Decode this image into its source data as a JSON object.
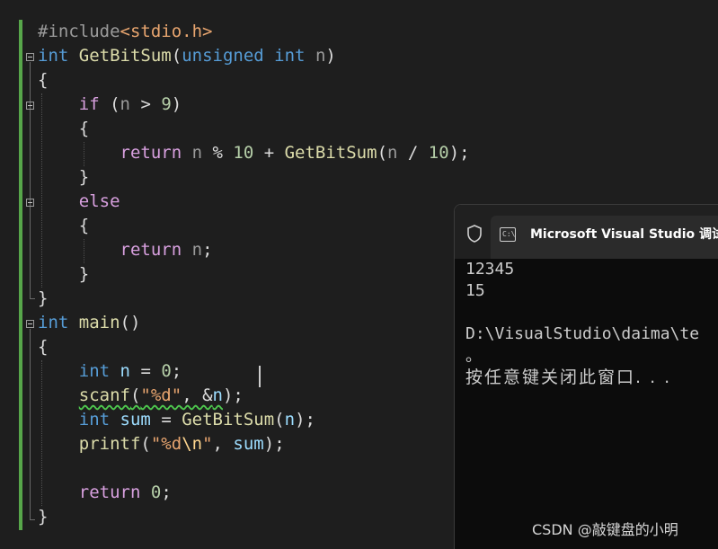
{
  "editor": {
    "lines": [
      {
        "tokens": [
          {
            "t": "#include",
            "c": "pp"
          },
          {
            "t": "<stdio.h>",
            "c": "inc"
          }
        ]
      },
      {
        "tokens": [
          {
            "t": "int",
            "c": "kw"
          },
          {
            "t": " ",
            "c": ""
          },
          {
            "t": "GetBitSum",
            "c": "fn"
          },
          {
            "t": "(",
            "c": ""
          },
          {
            "t": "unsigned",
            "c": "kw"
          },
          {
            "t": " ",
            "c": ""
          },
          {
            "t": "int",
            "c": "kw"
          },
          {
            "t": " ",
            "c": ""
          },
          {
            "t": "n",
            "c": "param"
          },
          {
            "t": ")",
            "c": ""
          }
        ]
      },
      {
        "tokens": [
          {
            "t": "{",
            "c": ""
          }
        ]
      },
      {
        "tokens": [
          {
            "t": "    ",
            "c": ""
          },
          {
            "t": "if",
            "c": "ctrl"
          },
          {
            "t": " (",
            "c": ""
          },
          {
            "t": "n",
            "c": "param"
          },
          {
            "t": " > ",
            "c": ""
          },
          {
            "t": "9",
            "c": "num"
          },
          {
            "t": ")",
            "c": ""
          }
        ]
      },
      {
        "tokens": [
          {
            "t": "    {",
            "c": ""
          }
        ]
      },
      {
        "tokens": [
          {
            "t": "        ",
            "c": ""
          },
          {
            "t": "return",
            "c": "ctrl"
          },
          {
            "t": " ",
            "c": ""
          },
          {
            "t": "n",
            "c": "param"
          },
          {
            "t": " % ",
            "c": ""
          },
          {
            "t": "10",
            "c": "num"
          },
          {
            "t": " + ",
            "c": ""
          },
          {
            "t": "GetBitSum",
            "c": "fn"
          },
          {
            "t": "(",
            "c": ""
          },
          {
            "t": "n",
            "c": "param"
          },
          {
            "t": " / ",
            "c": ""
          },
          {
            "t": "10",
            "c": "num"
          },
          {
            "t": ");",
            "c": ""
          }
        ]
      },
      {
        "tokens": [
          {
            "t": "    }",
            "c": ""
          }
        ]
      },
      {
        "tokens": [
          {
            "t": "    ",
            "c": ""
          },
          {
            "t": "else",
            "c": "ctrl"
          }
        ]
      },
      {
        "tokens": [
          {
            "t": "    {",
            "c": ""
          }
        ]
      },
      {
        "tokens": [
          {
            "t": "        ",
            "c": ""
          },
          {
            "t": "return",
            "c": "ctrl"
          },
          {
            "t": " ",
            "c": ""
          },
          {
            "t": "n",
            "c": "param"
          },
          {
            "t": ";",
            "c": ""
          }
        ]
      },
      {
        "tokens": [
          {
            "t": "    }",
            "c": ""
          }
        ]
      },
      {
        "tokens": [
          {
            "t": "}",
            "c": ""
          }
        ]
      },
      {
        "tokens": [
          {
            "t": "int",
            "c": "kw"
          },
          {
            "t": " ",
            "c": ""
          },
          {
            "t": "main",
            "c": "fn"
          },
          {
            "t": "()",
            "c": ""
          }
        ]
      },
      {
        "tokens": [
          {
            "t": "{",
            "c": ""
          }
        ]
      },
      {
        "tokens": []
      },
      {
        "tokens": [
          {
            "t": "    ",
            "c": ""
          },
          {
            "t": "int",
            "c": "kw"
          },
          {
            "t": " ",
            "c": ""
          },
          {
            "t": "n",
            "c": "local"
          },
          {
            "t": " = ",
            "c": ""
          },
          {
            "t": "0",
            "c": "num"
          },
          {
            "t": ";",
            "c": ""
          }
        ]
      },
      {
        "tokens": [
          {
            "t": "    ",
            "c": ""
          },
          {
            "t": "scanf",
            "c": "fn",
            "sq": true
          },
          {
            "t": "(",
            "c": "",
            "sq": true
          },
          {
            "t": "\"%d\"",
            "c": "str",
            "sq": true
          },
          {
            "t": ", &",
            "c": "",
            "sq": true
          },
          {
            "t": "n",
            "c": "local",
            "sq": true
          },
          {
            "t": ");",
            "c": ""
          }
        ]
      },
      {
        "tokens": [
          {
            "t": "    ",
            "c": ""
          },
          {
            "t": "int",
            "c": "kw"
          },
          {
            "t": " ",
            "c": ""
          },
          {
            "t": "sum",
            "c": "local"
          },
          {
            "t": " = ",
            "c": ""
          },
          {
            "t": "GetBitSum",
            "c": "fn"
          },
          {
            "t": "(",
            "c": ""
          },
          {
            "t": "n",
            "c": "local"
          },
          {
            "t": ");",
            "c": ""
          }
        ]
      },
      {
        "tokens": [
          {
            "t": "    ",
            "c": ""
          },
          {
            "t": "printf",
            "c": "fn"
          },
          {
            "t": "(",
            "c": ""
          },
          {
            "t": "\"%d",
            "c": "str"
          },
          {
            "t": "\\n",
            "c": "esc"
          },
          {
            "t": "\"",
            "c": "str"
          },
          {
            "t": ", ",
            "c": ""
          },
          {
            "t": "sum",
            "c": "local"
          },
          {
            "t": ");",
            "c": ""
          }
        ]
      },
      {
        "tokens": []
      },
      {
        "tokens": [
          {
            "t": "    ",
            "c": ""
          },
          {
            "t": "return",
            "c": "ctrl"
          },
          {
            "t": " ",
            "c": ""
          },
          {
            "t": "0",
            "c": "num"
          },
          {
            "t": ";",
            "c": ""
          }
        ]
      },
      {
        "tokens": [
          {
            "t": "}",
            "c": ""
          }
        ]
      }
    ]
  },
  "console": {
    "title": "Microsoft Visual Studio 调试控",
    "icon_names": [
      "shield-icon",
      "console-app-icon"
    ],
    "cmd_icon_glyph": "C:\\",
    "output": [
      "12345",
      "15",
      "",
      "D:\\VisualStudio\\daima\\te",
      "。",
      "按任意键关闭此窗口. . ."
    ]
  },
  "watermark": "CSDN @敲键盘的小明",
  "colors": {
    "editor_bg": "#1e1e1e",
    "keyword": "#569cd6",
    "control": "#d8a0df",
    "function": "#dcdcaa",
    "number": "#b5cea8",
    "string": "#e8a56f",
    "change_bar": "#57a64a",
    "console_bg": "#0c0c0c"
  }
}
